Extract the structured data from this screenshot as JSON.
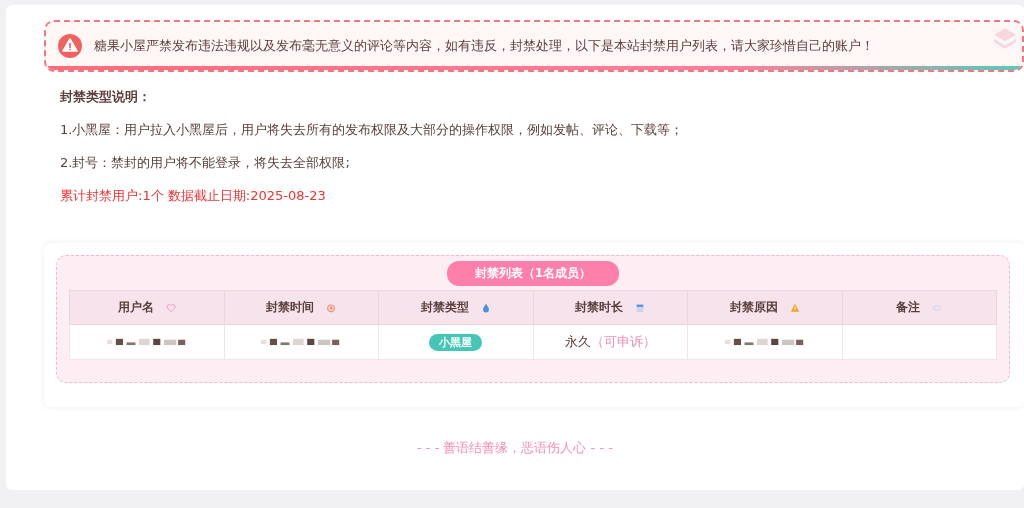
{
  "notice": {
    "text": "糖果小屋严禁发布违法违规以及发布毫无意义的评论等内容，如有违反，封禁处理，以下是本站封禁用户列表，请大家珍惜自己的账户！"
  },
  "description": {
    "heading": "封禁类型说明：",
    "items": [
      "1.小黑屋：用户拉入小黑屋后，用户将失去所有的发布权限及大部分的操作权限，例如发帖、评论、下载等；",
      "2.封号：禁封的用户将不能登录，将失去全部权限;"
    ],
    "summary": "累计封禁用户:1个 数据截止日期:2025-08-23"
  },
  "table": {
    "title": "封禁列表（1名成员）",
    "columns": [
      {
        "label": "用户名"
      },
      {
        "label": "封禁时间"
      },
      {
        "label": "封禁类型"
      },
      {
        "label": "封禁时长"
      },
      {
        "label": "封禁原因"
      },
      {
        "label": "备注"
      }
    ],
    "rows": [
      {
        "cells": [
          {
            "kind": "redacted"
          },
          {
            "kind": "redacted"
          },
          {
            "kind": "tag",
            "text": "小黑屋"
          },
          {
            "kind": "duration",
            "text": "永久",
            "note": "（可申诉）"
          },
          {
            "kind": "redacted"
          },
          {
            "kind": "empty"
          }
        ]
      }
    ]
  },
  "footer": "- - - 善语结善缘，恶语伤人心 - - -"
}
